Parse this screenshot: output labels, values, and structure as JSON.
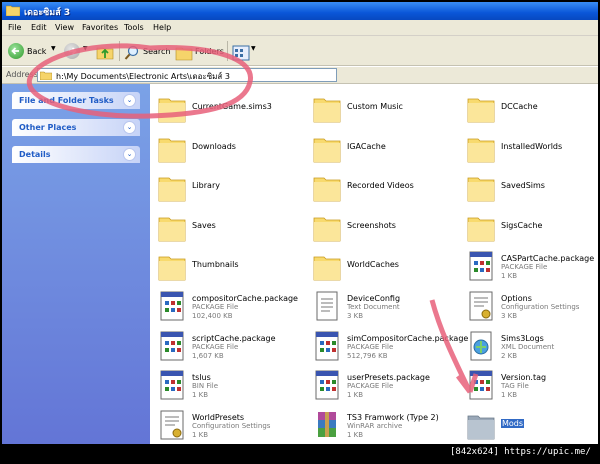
{
  "window": {
    "title": "เดอะซิมส์ 3"
  },
  "menu": [
    "File",
    "Edit",
    "View",
    "Favorites",
    "Tools",
    "Help"
  ],
  "toolbar": {
    "back_label": "Back",
    "search_label": "Search",
    "folders_label": "Folders"
  },
  "address": {
    "label": "Address",
    "path": "h:\\My Documents\\Electronic Arts\\เดอะซิมส์ 3"
  },
  "tasks": [
    "File and Folder Tasks",
    "Other Places",
    "Details"
  ],
  "items": [
    {
      "name": "CurrentGame.sims3",
      "kind": "folder"
    },
    {
      "name": "Custom Music",
      "kind": "folder"
    },
    {
      "name": "DCCache",
      "kind": "folder"
    },
    {
      "name": "Downloads",
      "kind": "folder"
    },
    {
      "name": "IGACache",
      "kind": "folder"
    },
    {
      "name": "InstalledWorlds",
      "kind": "folder"
    },
    {
      "name": "Library",
      "kind": "folder"
    },
    {
      "name": "Recorded Videos",
      "kind": "folder"
    },
    {
      "name": "SavedSims",
      "kind": "folder"
    },
    {
      "name": "Saves",
      "kind": "folder"
    },
    {
      "name": "Screenshots",
      "kind": "folder"
    },
    {
      "name": "SigsCache",
      "kind": "folder"
    },
    {
      "name": "Thumbnails",
      "kind": "folder"
    },
    {
      "name": "WorldCaches",
      "kind": "folder"
    },
    {
      "name": "CASPartCache.package",
      "type": "PACKAGE File",
      "size": "1 KB",
      "kind": "package"
    },
    {
      "name": "compositorCache.package",
      "type": "PACKAGE File",
      "size": "102,400 KB",
      "kind": "package"
    },
    {
      "name": "DeviceConfig",
      "type": "Text Document",
      "size": "3 KB",
      "kind": "text"
    },
    {
      "name": "Options",
      "type": "Configuration Settings",
      "size": "3 KB",
      "kind": "config"
    },
    {
      "name": "scriptCache.package",
      "type": "PACKAGE File",
      "size": "1,607 KB",
      "kind": "package"
    },
    {
      "name": "simCompositorCache.package",
      "type": "PACKAGE File",
      "size": "512,796 KB",
      "kind": "package"
    },
    {
      "name": "Sims3Logs",
      "type": "XML Document",
      "size": "2 KB",
      "kind": "xml"
    },
    {
      "name": "tslus",
      "type": "BIN File",
      "size": "1 KB",
      "kind": "package"
    },
    {
      "name": "userPresets.package",
      "type": "PACKAGE File",
      "size": "1 KB",
      "kind": "package"
    },
    {
      "name": "Version.tag",
      "type": "TAG File",
      "size": "1 KB",
      "kind": "package"
    },
    {
      "name": "WorldPresets",
      "type": "Configuration Settings",
      "size": "1 KB",
      "kind": "config"
    },
    {
      "name": "TS3 Framwork (Type 2)",
      "type": "WinRAR archive",
      "size": "1 KB",
      "kind": "rar"
    },
    {
      "name": "Mods",
      "kind": "folder",
      "selected": true
    }
  ],
  "stamp": "[842x624] https://upic.me/",
  "colors": {
    "titlebar": "#0a56d8",
    "taskpane": "#7ba2e7",
    "annotation": "#e8607a",
    "selection": "#316ac5"
  }
}
